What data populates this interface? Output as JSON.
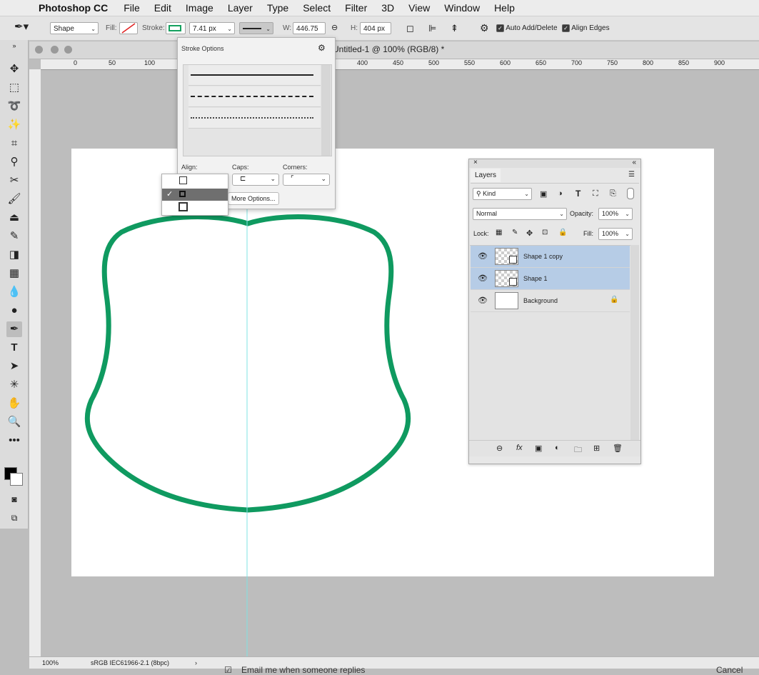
{
  "menubar": {
    "apple_icon": "apple-logo",
    "app_name": "Photoshop CC",
    "items": [
      "File",
      "Edit",
      "Image",
      "Layer",
      "Type",
      "Select",
      "Filter",
      "3D",
      "View",
      "Window",
      "Help"
    ]
  },
  "options": {
    "mode": "Shape",
    "fill_label": "Fill:",
    "stroke_label": "Stroke:",
    "stroke_width": "7.41 px",
    "w_label": "W:",
    "w_value": "446.75 p",
    "h_label": "H:",
    "h_value": "404 px",
    "auto_add": "Auto Add/Delete",
    "align_edges": "Align Edges",
    "stroke_color": "#13a05e"
  },
  "document": {
    "title": "Untitled-1 @ 100% (RGB/8) *",
    "ruler_labels": [
      "0",
      "50",
      "100",
      "400",
      "450",
      "500",
      "550",
      "600",
      "650",
      "700",
      "750",
      "800",
      "850",
      "900"
    ],
    "zoom": "100%",
    "profile": "sRGB IEC61966-2.1 (8bpc)"
  },
  "stroke_options": {
    "title": "Stroke Options",
    "align_label": "Align:",
    "caps_label": "Caps:",
    "corners_label": "Corners:",
    "more_options": "More Options..."
  },
  "layers_panel": {
    "tab": "Layers",
    "kind": "Kind",
    "blend_mode": "Normal",
    "opacity_label": "Opacity:",
    "opacity_value": "100%",
    "lock_label": "Lock:",
    "fill_label": "Fill:",
    "fill_value": "100%",
    "layers": [
      {
        "name": "Shape 1 copy",
        "selected": true
      },
      {
        "name": "Shape 1",
        "selected": true
      },
      {
        "name": "Background",
        "selected": false,
        "locked": true
      }
    ]
  },
  "below": {
    "email_text": "Email me when someone replies",
    "cancel": "Cancel"
  },
  "colors": {
    "shape_stroke": "#0f9a60",
    "guide": "#7fe3e3",
    "selection": "#b6cce6"
  }
}
